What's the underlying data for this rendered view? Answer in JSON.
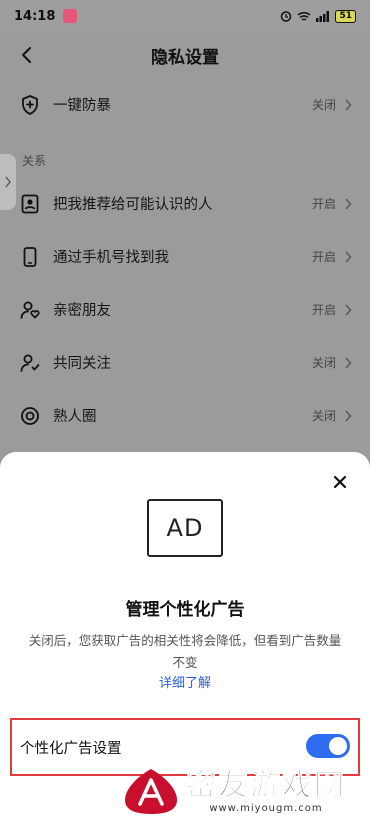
{
  "status_bar": {
    "time": "14:18",
    "battery": "51"
  },
  "header": {
    "title": "隐私设置"
  },
  "top_item": {
    "label": "一键防暴",
    "value": "关闭"
  },
  "section": {
    "label": "关系"
  },
  "items": [
    {
      "label": "把我推荐给可能认识的人",
      "value": "开启",
      "icon": "contact-card-icon"
    },
    {
      "label": "通过手机号找到我",
      "value": "开启",
      "icon": "phone-icon"
    },
    {
      "label": "亲密朋友",
      "value": "开启",
      "icon": "close-friend-icon"
    },
    {
      "label": "共同关注",
      "value": "关闭",
      "icon": "mutual-follow-icon"
    },
    {
      "label": "熟人圈",
      "value": "关闭",
      "icon": "circle-icon"
    }
  ],
  "sheet": {
    "ad_label": "AD",
    "title": "管理个性化广告",
    "description": "关闭后，您获取广告的相关性将会降低，但看到广告数量不变",
    "learn_more": "详细了解",
    "toggle_label": "个性化广告设置"
  },
  "watermark": {
    "title": "密友游戏网",
    "url": "www.miyougm.com"
  },
  "colors": {
    "accent": "#2f6df0",
    "link": "#2b5fd9",
    "highlight": "#e33b3b"
  }
}
